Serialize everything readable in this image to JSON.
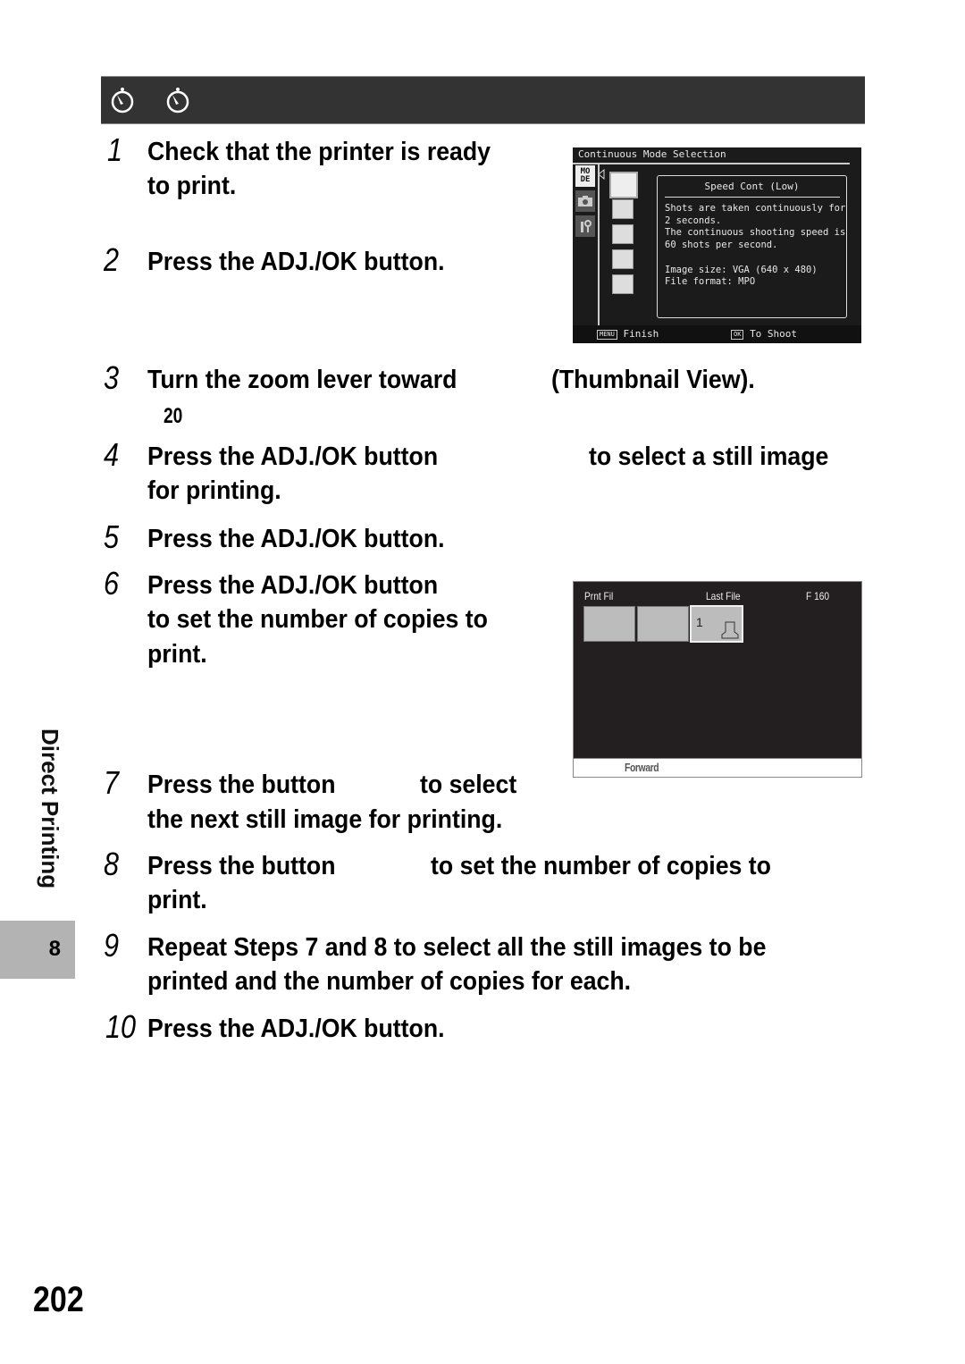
{
  "header": {
    "icons": [
      "self-timer-icon",
      "self-timer-icon"
    ]
  },
  "steps": [
    {
      "num": "1",
      "lines": [
        "Check that the printer is ready",
        "to print."
      ]
    },
    {
      "num": "2",
      "lines": [
        "Press the ADJ./OK button."
      ]
    },
    {
      "num": "3",
      "lines": [
        "Turn the zoom lever toward",
        "(Thumbnail View)."
      ],
      "ref": "20"
    },
    {
      "num": "4",
      "lines": [
        "Press the ADJ./OK button",
        "to select a still image",
        "for printing."
      ]
    },
    {
      "num": "5",
      "lines": [
        "Press the ADJ./OK button."
      ]
    },
    {
      "num": "6",
      "lines": [
        "Press the ADJ./OK button",
        "to set the number of copies to",
        "print."
      ]
    },
    {
      "num": "7",
      "lines": [
        "Press the button",
        "to select",
        "the next still image for printing."
      ]
    },
    {
      "num": "8",
      "lines": [
        "Press the button",
        "to set the number of copies to",
        "print."
      ]
    },
    {
      "num": "9",
      "lines": [
        "Repeat Steps 7 and 8 to select all the still images to be",
        "printed and the number of copies for each."
      ]
    },
    {
      "num": "10",
      "lines": [
        "Press the ADJ./OK button."
      ]
    }
  ],
  "screen1": {
    "title": "Continuous Mode Selection",
    "tabs": [
      "MO\nDE",
      "camera",
      "tools"
    ],
    "mode_tab": "MO DE",
    "icons": [
      "continuous",
      "M-cont-5M",
      "M-cont-2M",
      "speed-cont-60",
      "speed-cont-120"
    ],
    "box_title": "Speed Cont (Low)",
    "box_body": "Shots are taken continuously for\n2 seconds.\nThe continuous shooting speed is\n60 shots per second.\n\nImage size: VGA (640 x 480)\nFile format: MPO",
    "footer_left_key": "MENU",
    "footer_left": "Finish",
    "footer_right_key": "OK",
    "footer_right": "To Shoot"
  },
  "screen2": {
    "left_label": "Prnt Fil",
    "mid_label": "Last File",
    "right_label": "F 160",
    "selected_copies": "1",
    "footer": "Forward"
  },
  "sidebar": {
    "section_title": "Direct Printing",
    "chapter": "8"
  },
  "page_number": "202"
}
